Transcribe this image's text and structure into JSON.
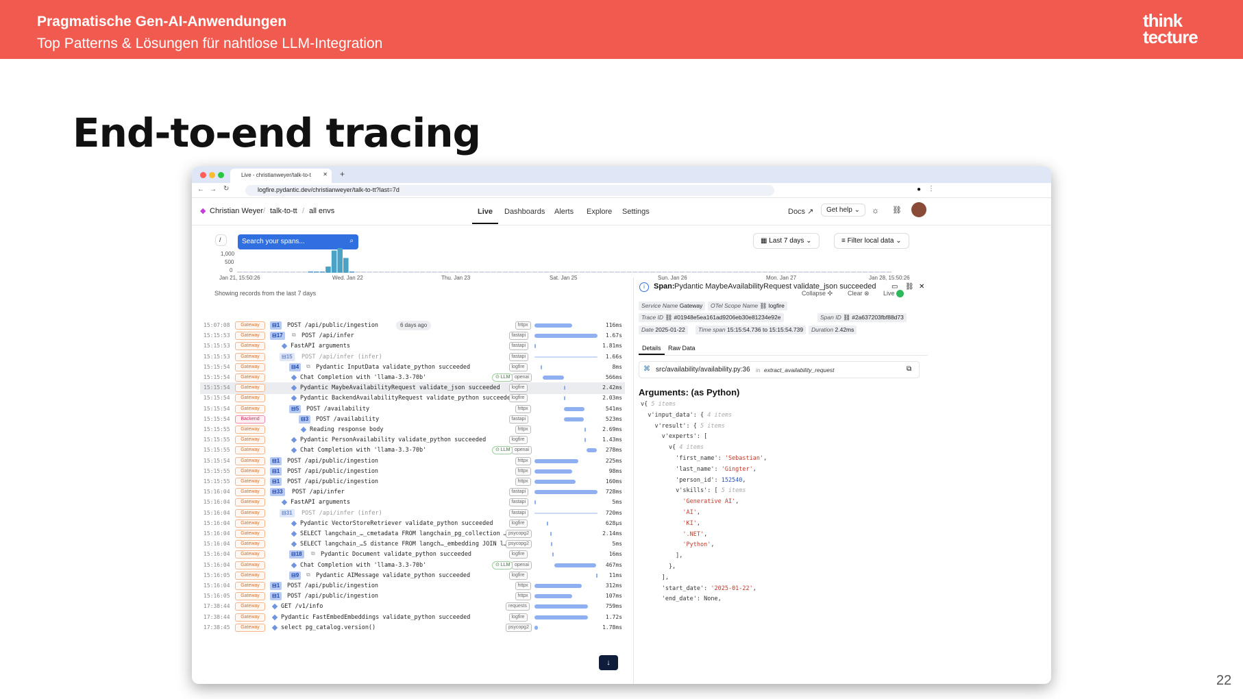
{
  "slide": {
    "header_title": "Pragmatische Gen-AI-Anwendungen",
    "header_subtitle": "Top Patterns & Lösungen für nahtlose LLM-Integration",
    "logo_line1": "think",
    "logo_line2": "tecture",
    "title": "End-to-end tracing",
    "page_number": "22"
  },
  "browser": {
    "tab_title": "Live - christianweyer/talk-to-t",
    "url": "logfire.pydantic.dev/christianweyer/talk-to-tt?last=7d"
  },
  "app": {
    "breadcrumb": [
      "Christian Weyer",
      "talk-to-tt",
      "all envs"
    ],
    "nav": [
      "Live",
      "Dashboards",
      "Alerts",
      "Explore",
      "Settings"
    ],
    "docs": "Docs",
    "get_help": "Get help",
    "slash": "/",
    "search_placeholder": "Search your spans...",
    "time_range": "Last 7 days",
    "filter": "Filter local data",
    "y_ticks": [
      "1,000",
      "500",
      "0"
    ],
    "x_ticks": [
      "Jan 21, 15:50:26",
      "Wed. Jan 22",
      "Thu. Jan 23",
      "Sat. Jan 25",
      "Sun. Jan 26",
      "Mon. Jan 27",
      "Jan 28, 15:50:26"
    ],
    "showing": "Showing records from the last 7 days",
    "collapse": "Collapse",
    "clear": "Clear",
    "live": "Live",
    "badge_ago": "6 days ago"
  },
  "histogram": [
    0,
    0,
    0,
    0,
    0,
    0,
    0,
    0,
    0,
    0,
    0,
    0,
    60,
    40,
    30,
    250,
    900,
    1000,
    600,
    20,
    0,
    0,
    0,
    0,
    0,
    0,
    0,
    0,
    0,
    0,
    0,
    0,
    0,
    0,
    0,
    0,
    0,
    0,
    0,
    0,
    0,
    0,
    0,
    0,
    0,
    0,
    0,
    0,
    0,
    0,
    0,
    0,
    0,
    0,
    0,
    0,
    0,
    0,
    0,
    0,
    0,
    0,
    0,
    0,
    0,
    0,
    0,
    0,
    0,
    0,
    0,
    0,
    0,
    0,
    0,
    0,
    0,
    0,
    0,
    0,
    0,
    0,
    0,
    0,
    0,
    0,
    0,
    0,
    0,
    0,
    0,
    0,
    0,
    0,
    0,
    0,
    0,
    0,
    0,
    0,
    0,
    0,
    0,
    0,
    0,
    0,
    0,
    0,
    0,
    0,
    0
  ],
  "rows": [
    {
      "time": "15:07:08",
      "svc": "Gateway",
      "cnt": "1",
      "indent": 0,
      "msg": "POST /api/public/ingestion",
      "tag": "httpx",
      "bar": [
        0,
        0.6
      ],
      "dur": "116ms",
      "ago": true
    },
    {
      "time": "15:15:53",
      "svc": "Gateway",
      "cnt": "17",
      "indent": 0,
      "msg": "POST /api/infer",
      "tag": "fastapi",
      "bar": [
        0,
        1
      ],
      "dur": "1.67s",
      "pre": "1"
    },
    {
      "time": "15:15:53",
      "svc": "Gateway",
      "indent": 1,
      "msg": "FastAPI arguments",
      "tag": "fastapi",
      "bar": [
        0,
        0.01
      ],
      "dur": "1.81ms",
      "diamond": true
    },
    {
      "time": "15:15:53",
      "svc": "Gateway",
      "cnt": "15",
      "indent": 1,
      "msg": "POST /api/infer (infer)",
      "tag": "fastapi",
      "bar": [
        0,
        1
      ],
      "dur": "1.66s",
      "dim": true,
      "light": true
    },
    {
      "time": "15:15:54",
      "svc": "Gateway",
      "cnt": "4",
      "indent": 2,
      "msg": "Pydantic InputData validate_python succeeded",
      "tag": "logfire",
      "bar": [
        0.1,
        0.01
      ],
      "dur": "8ms",
      "pre": "1"
    },
    {
      "time": "15:15:54",
      "svc": "Gateway",
      "indent": 2,
      "msg": "Chat Completion with 'llama-3.3-70b'",
      "tag": "openai",
      "bar": [
        0.13,
        0.34
      ],
      "dur": "566ms",
      "diamond": true,
      "llm": true
    },
    {
      "time": "15:15:54",
      "svc": "Gateway",
      "indent": 2,
      "msg": "Pydantic MaybeAvailabilityRequest validate_json succeeded",
      "tag": "logfire",
      "bar": [
        0.47,
        0.005
      ],
      "dur": "2.42ms",
      "diamond": true,
      "sel": true
    },
    {
      "time": "15:15:54",
      "svc": "Gateway",
      "indent": 2,
      "msg": "Pydantic BackendAvailabilityRequest validate_python succeeded",
      "tag": "logfire",
      "bar": [
        0.47,
        0.005
      ],
      "dur": "2.03ms",
      "diamond": true
    },
    {
      "time": "15:15:54",
      "svc": "Gateway",
      "cnt": "5",
      "indent": 2,
      "msg": "POST /availability",
      "tag": "httpx",
      "bar": [
        0.47,
        0.32
      ],
      "dur": "541ms"
    },
    {
      "time": "15:15:54",
      "svc": "Backend",
      "cnt": "3",
      "indent": 3,
      "msg": "POST /availability",
      "tag": "fastapi",
      "bar": [
        0.47,
        0.31
      ],
      "dur": "523ms"
    },
    {
      "time": "15:15:55",
      "svc": "Gateway",
      "indent": 3,
      "msg": "Reading response body",
      "tag": "httpx",
      "bar": [
        0.79,
        0.005
      ],
      "dur": "2.69ms",
      "diamond": true
    },
    {
      "time": "15:15:55",
      "svc": "Gateway",
      "indent": 2,
      "msg": "Pydantic PersonAvailability validate_python succeeded",
      "tag": "logfire",
      "bar": [
        0.79,
        0.005
      ],
      "dur": "1.43ms",
      "diamond": true
    },
    {
      "time": "15:15:55",
      "svc": "Gateway",
      "indent": 2,
      "msg": "Chat Completion with 'llama-3.3-70b'",
      "tag": "openai",
      "bar": [
        0.83,
        0.16
      ],
      "dur": "278ms",
      "diamond": true,
      "llm": true
    },
    {
      "time": "15:15:54",
      "svc": "Gateway",
      "cnt": "1",
      "indent": 0,
      "msg": "POST /api/public/ingestion",
      "tag": "httpx",
      "bar": [
        0,
        0.7
      ],
      "dur": "225ms"
    },
    {
      "time": "15:15:55",
      "svc": "Gateway",
      "cnt": "1",
      "indent": 0,
      "msg": "POST /api/public/ingestion",
      "tag": "httpx",
      "bar": [
        0,
        0.6
      ],
      "dur": "98ms"
    },
    {
      "time": "15:15:55",
      "svc": "Gateway",
      "cnt": "1",
      "indent": 0,
      "msg": "POST /api/public/ingestion",
      "tag": "httpx",
      "bar": [
        0,
        0.65
      ],
      "dur": "160ms"
    },
    {
      "time": "15:16:04",
      "svc": "Gateway",
      "cnt": "33",
      "indent": 0,
      "msg": "POST /api/infer",
      "tag": "fastapi",
      "bar": [
        0,
        1
      ],
      "dur": "728ms"
    },
    {
      "time": "15:16:04",
      "svc": "Gateway",
      "indent": 1,
      "msg": "FastAPI arguments",
      "tag": "fastapi",
      "bar": [
        0,
        0.01
      ],
      "dur": "5ms",
      "diamond": true
    },
    {
      "time": "15:16:04",
      "svc": "Gateway",
      "cnt": "31",
      "indent": 1,
      "msg": "POST /api/infer (infer)",
      "tag": "fastapi",
      "bar": [
        0,
        1
      ],
      "dur": "720ms",
      "dim": true,
      "light": true
    },
    {
      "time": "15:16:04",
      "svc": "Gateway",
      "indent": 2,
      "msg": "Pydantic VectorStoreRetriever validate_python succeeded",
      "tag": "logfire",
      "bar": [
        0.2,
        0.01
      ],
      "dur": "628µs",
      "diamond": true
    },
    {
      "time": "15:16:04",
      "svc": "Gateway",
      "indent": 2,
      "msg": "SELECT langchain_…_cmetadata FROM langchain_pg_collection …",
      "tag": "psycopg2",
      "bar": [
        0.25,
        0.01
      ],
      "dur": "2.14ms",
      "diamond": true
    },
    {
      "time": "15:16:04",
      "svc": "Gateway",
      "indent": 2,
      "msg": "SELECT langchain_…S distance FROM langch…_embedding JOIN l…",
      "tag": "psycopg2",
      "bar": [
        0.26,
        0.01
      ],
      "dur": "5ms",
      "diamond": true
    },
    {
      "time": "15:16:04",
      "svc": "Gateway",
      "cnt": "18",
      "indent": 2,
      "msg": "Pydantic Document validate_python succeeded",
      "tag": "logfire",
      "bar": [
        0.28,
        0.02
      ],
      "dur": "16ms",
      "pre": "1"
    },
    {
      "time": "15:16:04",
      "svc": "Gateway",
      "indent": 2,
      "msg": "Chat Completion with 'llama-3.3-70b'",
      "tag": "openai",
      "bar": [
        0.32,
        0.66
      ],
      "dur": "467ms",
      "diamond": true,
      "llm": true
    },
    {
      "time": "15:16:05",
      "svc": "Gateway",
      "cnt": "9",
      "indent": 2,
      "msg": "Pydantic AIMessage validate_python succeeded",
      "tag": "logfire",
      "bar": [
        0.98,
        0.01
      ],
      "dur": "11ms",
      "pre": "1"
    },
    {
      "time": "15:16:04",
      "svc": "Gateway",
      "cnt": "1",
      "indent": 0,
      "msg": "POST /api/public/ingestion",
      "tag": "httpx",
      "bar": [
        0,
        0.75
      ],
      "dur": "312ms"
    },
    {
      "time": "15:16:05",
      "svc": "Gateway",
      "cnt": "1",
      "indent": 0,
      "msg": "POST /api/public/ingestion",
      "tag": "httpx",
      "bar": [
        0,
        0.6
      ],
      "dur": "107ms"
    },
    {
      "time": "17:38:44",
      "svc": "Gateway",
      "indent": 0,
      "msg": "GET /v1/info",
      "tag": "requests",
      "bar": [
        0,
        0.85
      ],
      "dur": "759ms",
      "diamond": true
    },
    {
      "time": "17:38:44",
      "svc": "Gateway",
      "indent": 0,
      "msg": "Pydantic FastEmbedEmbeddings validate_python succeeded",
      "tag": "logfire",
      "bar": [
        0,
        0.85
      ],
      "dur": "1.72s",
      "diamond": true
    },
    {
      "time": "17:38:45",
      "svc": "Gateway",
      "indent": 0,
      "msg": "select pg_catalog.version()",
      "tag": "psycopg2",
      "bar": [
        0,
        0.05
      ],
      "dur": "1.78ms",
      "diamond": true
    }
  ],
  "detail": {
    "span_label": "Span:",
    "span_title": "Pydantic MaybeAvailabilityRequest validate_json succeeded",
    "service_name_label": "Service Name",
    "service_name": "Gateway",
    "otel_label": "OTel Scope Name",
    "otel": "logfire",
    "trace_label": "Trace ID",
    "trace_id": "#01948e5ea161ad9206eb30e81234e92e",
    "span_id_label": "Span ID",
    "span_id": "#2a637203fbf88d73",
    "date_label": "Date",
    "date": "2025-01-22",
    "timespan_label": "Time span",
    "timespan": "15:15:54.736 to 15:15:54.739",
    "duration_label": "Duration",
    "duration": "2.42ms",
    "tab_details": "Details",
    "tab_raw": "Raw Data",
    "source": "src/availability/availability.py:36",
    "source_in": "in",
    "source_fn": "extract_availability_request",
    "args_title": "Arguments: (as Python)"
  },
  "code_lines": [
    "v{ 5 items",
    "  v'input_data': { 4 items",
    "    v'result': { 5 items",
    "      v'experts': [",
    "        v{ 4 items",
    "          'first_name': 'Sebastian',",
    "          'last_name': 'Gingter',",
    "          'person_id': 152540,",
    "          v'skills': [ 5 items",
    "            'Generative AI',",
    "            'AI',",
    "            'KI',",
    "            '.NET',",
    "            'Python',",
    "          ],",
    "        },",
    "      ],",
    "      'start_date': '2025-01-22',",
    "      'end_date': None,"
  ]
}
